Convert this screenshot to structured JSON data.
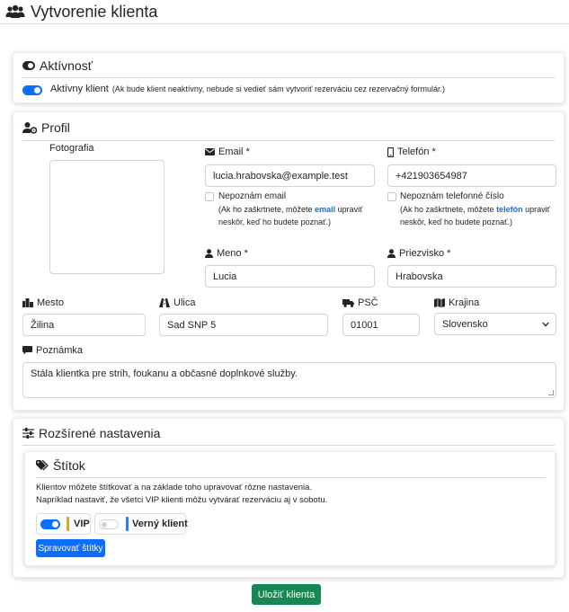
{
  "page": {
    "title": "Vytvorenie klienta"
  },
  "activity": {
    "title": "Aktívnosť",
    "active_label": "Aktívny klient",
    "active_hint": "(Ak bude klient neaktívny, nebude si vedieť sám vytvoriť rezerváciu cez rezervačný formulár.)",
    "active": true
  },
  "profile": {
    "title": "Profil",
    "photo_label": "Fotografia",
    "email": {
      "label": "Email *",
      "value": "lucia.hrabovska@example.test",
      "unknown_label": "Nepoznám email",
      "hint_prefix": "(Ak ho zaškrtnete, môžete",
      "hint_link": "email",
      "hint_suffix": "upraviť",
      "hint_line2": "neskôr, keď ho budete poznať.)"
    },
    "phone": {
      "label": "Telefón *",
      "value": "+421903654987",
      "unknown_label": "Nepoznám telefonné číslo",
      "hint_prefix": "(Ak ho zaškrtnete, môžete",
      "hint_link": "telefón",
      "hint_suffix": "upraviť",
      "hint_line2": "neskôr, keď ho budete poznať.)"
    },
    "first_name": {
      "label": "Meno *",
      "value": "Lucia"
    },
    "last_name": {
      "label": "Priezvisko *",
      "value": "Hrabovska"
    },
    "city": {
      "label": "Mesto",
      "value": "Žilina"
    },
    "street": {
      "label": "Ulica",
      "value": "Sad SNP 5"
    },
    "zip": {
      "label": "PSČ",
      "value": "01001"
    },
    "country": {
      "label": "Krajina",
      "value": "Slovensko"
    },
    "note": {
      "label": "Poznámka",
      "value": "Stála klientka pre strih, foukanu a občasné doplnkové služby."
    }
  },
  "advanced": {
    "title": "Rozšírené nastavenia",
    "tags": {
      "title": "Štítok",
      "desc1": "Klientov môžete štítkovať a na základe toho upravovať rôzne nastavenia.",
      "desc2": "Napríklad nastaviť, že všetci VIP klienti môžu vytvárať rezerváciu aj v sobotu.",
      "items": [
        {
          "label": "VIP",
          "enabled": true,
          "color": "#d4a72c"
        },
        {
          "label": "Verný klient",
          "enabled": false,
          "color": "#2f80ed"
        }
      ],
      "manage_button": "Spravovať štítky"
    }
  },
  "actions": {
    "save_button": "Uložiť klienta"
  },
  "colors": {
    "primary": "#0d6efd",
    "success": "#198754"
  }
}
